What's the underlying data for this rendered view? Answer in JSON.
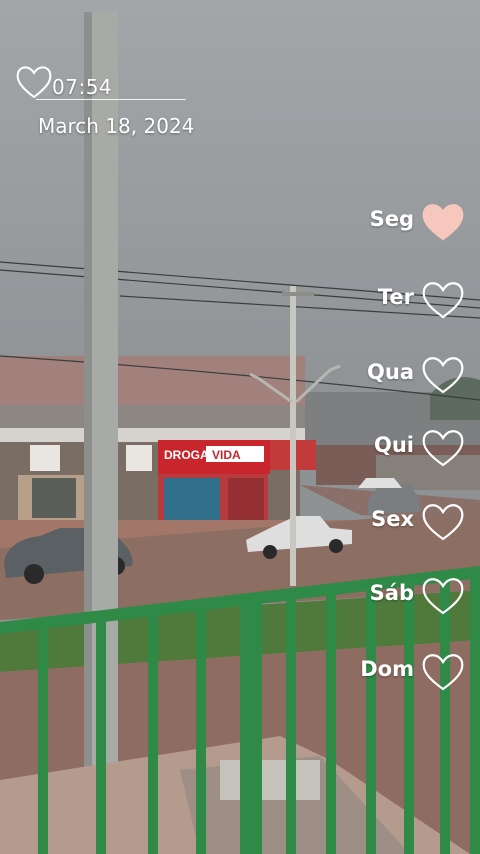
{
  "overlay": {
    "time": "07:54",
    "date": "March 18, 2024",
    "heart_icon": "heart-outline-icon"
  },
  "store_sign": {
    "name_part1": "DROGA",
    "name_part2": "VIDA"
  },
  "week": {
    "days": [
      {
        "label": "Seg",
        "filled": true
      },
      {
        "label": "Ter",
        "filled": false
      },
      {
        "label": "Qua",
        "filled": false
      },
      {
        "label": "Qui",
        "filled": false
      },
      {
        "label": "Sex",
        "filled": false
      },
      {
        "label": "Sáb",
        "filled": false
      },
      {
        "label": "Dom",
        "filled": false
      }
    ],
    "filled_color": "#f6c8bd",
    "outline_color": "#ffffff"
  },
  "colors": {
    "sky": "#9a9ea2",
    "railing": "#2f8a47",
    "sign_red": "#c8262c"
  }
}
